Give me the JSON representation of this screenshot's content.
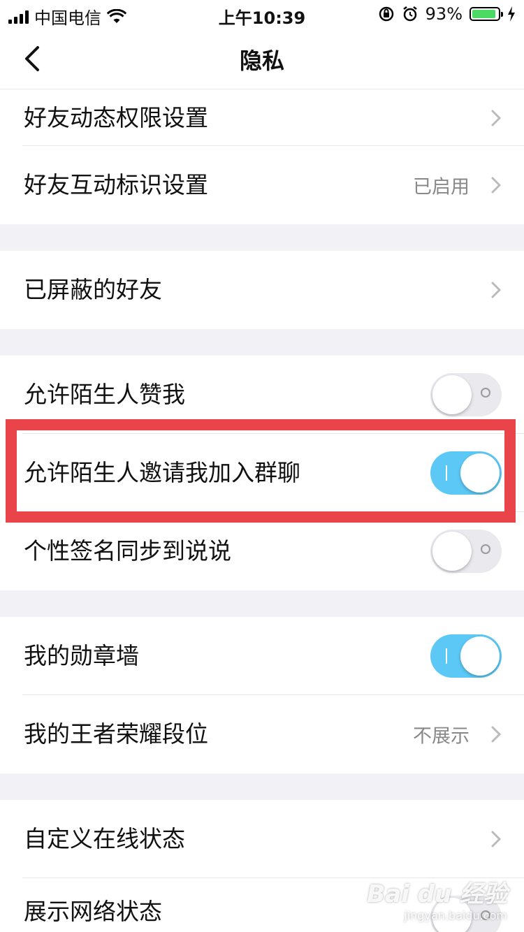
{
  "status": {
    "carrier": "中国电信",
    "time": "上午10:39",
    "battery_percent": "93%",
    "battery_level": 0.93
  },
  "nav": {
    "title": "隐私",
    "back_icon": "chevron-left-icon"
  },
  "rows": {
    "friend_feed_permission": {
      "label": "好友动态权限设置"
    },
    "friend_interaction_badge": {
      "label": "好友互动标识设置",
      "value": "已启用"
    },
    "blocked_friends": {
      "label": "已屏蔽的好友"
    },
    "allow_stranger_like": {
      "label": "允许陌生人赞我",
      "on": false
    },
    "allow_stranger_group_invite": {
      "label": "允许陌生人邀请我加入群聊",
      "on": true
    },
    "sync_signature_to_qzone": {
      "label": "个性签名同步到说说",
      "on": false
    },
    "my_badge_wall": {
      "label": "我的勋章墙",
      "on": true
    },
    "my_honor_of_kings_rank": {
      "label": "我的王者荣耀段位",
      "value": "不展示"
    },
    "custom_online_status": {
      "label": "自定义在线状态"
    },
    "show_network_status": {
      "label": "展示网络状态",
      "on": false
    }
  },
  "colors": {
    "toggle_on": "#5bc8f5",
    "toggle_off": "#e9e9ee",
    "highlight": "#e8444a",
    "battery": "#4cd964"
  },
  "watermark": {
    "logo": "Bai du 经验",
    "url": "jingyan.baidu.com"
  }
}
